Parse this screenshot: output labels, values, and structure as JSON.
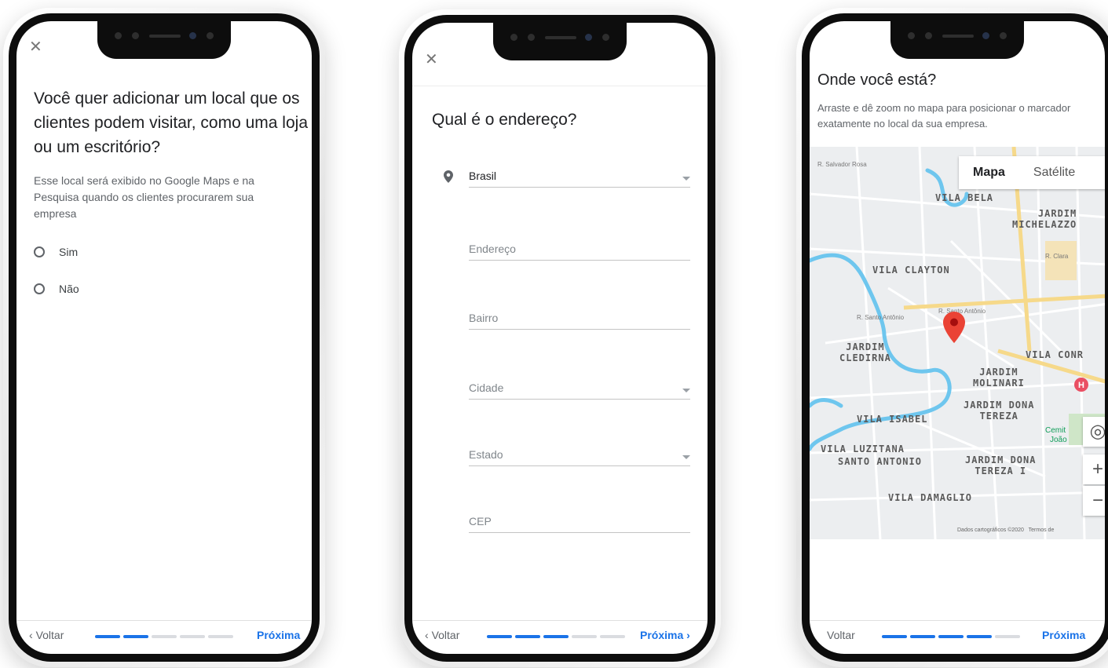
{
  "colors": {
    "accent": "#1a73e8",
    "marker": "#ea4335"
  },
  "phone1": {
    "close_icon": "close-icon",
    "title": "Você quer adicionar um local que os clientes podem visitar, como uma loja ou um escritório?",
    "description": "Esse local será exibido no Google Maps e na Pesquisa quando os clientes procurarem sua empresa",
    "options": [
      {
        "label": "Sim",
        "selected": false
      },
      {
        "label": "Não",
        "selected": false
      }
    ],
    "nav": {
      "back": "Voltar",
      "next": "Próxima",
      "steps_done": 2,
      "steps_total": 5
    }
  },
  "phone2": {
    "close_icon": "close-icon",
    "title": "Qual é o endereço?",
    "country": "Brasil",
    "fields": {
      "address": "Endereço",
      "district": "Bairro",
      "city": "Cidade",
      "state": "Estado",
      "zip": "CEP"
    },
    "nav": {
      "back": "Voltar",
      "next": "Próxima",
      "steps_done": 3,
      "steps_total": 5
    }
  },
  "phone3": {
    "title": "Onde você está?",
    "description": "Arraste e dê zoom no mapa para posicionar o marcador exatamente no local da sua empresa.",
    "map": {
      "toggle_map": "Mapa",
      "toggle_satellite": "Satélite",
      "labels": {
        "vila_bela": "VILA BELA",
        "jardim_michelazzo": "JARDIM\nMICHELAZZO",
        "vila_clayton": "VILA CLAYTON",
        "jardim_cledirna": "JARDIM\nCLEDIRNA",
        "vila_conr": "VILA CONR",
        "jardim_molinari": "JARDIM\nMOLINARI",
        "jardim_dona_tereza": "JARDIM DONA\nTEREZA",
        "vila_isabel": "VILA ISABEL",
        "vila_luzitana": "VILA LUZITANA",
        "santo_antonio": "SANTO ANTONIO",
        "jardim_dona_tereza_i": "JARDIM DONA\nTEREZA I",
        "vila_damaglio": "VILA DAMAGLIO",
        "cemit": "Cemit",
        "joao": "João"
      },
      "streets": {
        "santo_antonio": "R. Santo Antônio",
        "santo_antonio_2": "R. Santo Antônio",
        "salvador_rosa": "R. Salvador Rosa",
        "clara": "R. Clara"
      },
      "attribution": "Dados cartográficos ©2020",
      "terms": "Termos de",
      "zoom_in": "+",
      "zoom_out": "−"
    },
    "nav": {
      "back": "Voltar",
      "next": "Próxima",
      "steps_done": 4,
      "steps_total": 5
    }
  }
}
